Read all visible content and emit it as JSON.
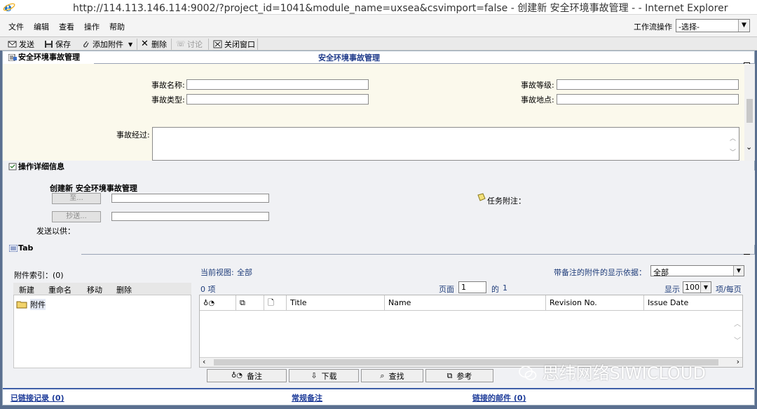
{
  "window": {
    "title": "http://114.113.146.114:9002/?project_id=1041&module_name=uxsea&csvimport=false - 创建新 安全环境事故管理 - - Internet Explorer"
  },
  "menu": {
    "items": [
      "文件",
      "编辑",
      "查看",
      "操作",
      "帮助"
    ],
    "workflow_label": "工作流操作",
    "workflow_value": "-选择-"
  },
  "toolbar": {
    "send": "发送",
    "save": "保存",
    "add_attachment": "添加附件",
    "delete": "删除",
    "discuss": "讨论",
    "close_window": "关闭窗口"
  },
  "form": {
    "section_tab": "安全环境事故管理",
    "section_title": "安全环境事故管理",
    "accident_name_label": "事故名称:",
    "accident_type_label": "事故类型:",
    "accident_level_label": "事故等级:",
    "accident_location_label": "事故地点:",
    "accident_process_label": "事故经过:"
  },
  "operation": {
    "section_tab": "操作详细信息",
    "create_title": "创建新 安全环境事故管理",
    "to_button": "至...",
    "cc_button": "抄送...",
    "send_for_label": "发送以供：",
    "task_note_label": "任务附注："
  },
  "tab": {
    "section_tab": "Tab",
    "attachment_index": "附件索引：(0)",
    "tree_toolbar": [
      "新建",
      "重命名",
      "移动",
      "删除"
    ],
    "tree_root": "附件",
    "current_view_label": "当前视图:",
    "current_view_value": "全部",
    "note_basis_label": "带备注的附件的显示依据：",
    "note_basis_value": "全部",
    "item_count": "0 项",
    "page_label": "页面",
    "page_value": "1",
    "of_label": "的",
    "page_total": "1",
    "show_label": "显示",
    "page_size": "100",
    "per_page": "项/每页",
    "columns": [
      "Title",
      "Name",
      "Revision No.",
      "Issue Date"
    ],
    "bottom_buttons": [
      "备注",
      "下载",
      "查找",
      "参考"
    ]
  },
  "status": {
    "linked_records": "已链接记录 (0)",
    "regular_notes": "常规备注",
    "linked_mail": "链接的邮件 (0)"
  },
  "watermark": "思纬网络SIWICLOUD"
}
